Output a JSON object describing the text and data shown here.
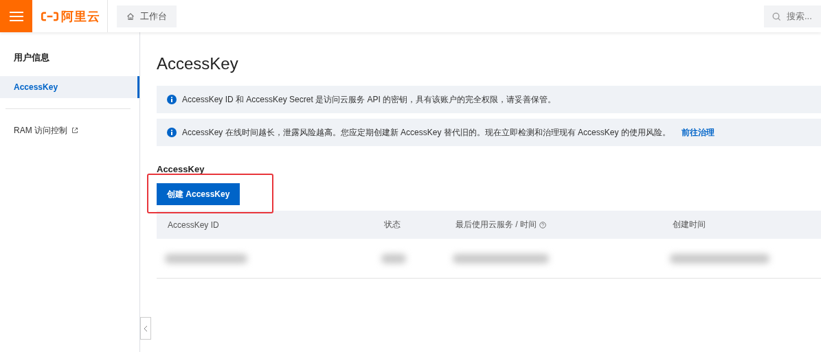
{
  "header": {
    "logo_text": "阿里云",
    "tab": "工作台",
    "search": {
      "placeholder": "搜索..."
    }
  },
  "sidebar": {
    "title": "用户信息",
    "items": [
      {
        "label": "AccessKey",
        "selected": true,
        "external": false
      },
      {
        "label": "RAM 访问控制",
        "selected": false,
        "external": true
      }
    ]
  },
  "page": {
    "title": "AccessKey",
    "alerts": [
      {
        "text": "AccessKey ID 和 AccessKey Secret 是访问云服务 API 的密钥，具有该账户的完全权限，请妥善保管。"
      },
      {
        "text": "AccessKey 在线时间越长，泄露风险越高。您应定期创建新 AccessKey 替代旧的。现在立即检测和治理现有 AccessKey 的使用风险。",
        "link": "前往治理"
      }
    ],
    "section_title": "AccessKey",
    "create_button": "创建 AccessKey",
    "table": {
      "columns": [
        {
          "label": "AccessKey ID",
          "help": false
        },
        {
          "label": "状态",
          "help": false
        },
        {
          "label": "最后使用云服务 / 时间",
          "help": true
        },
        {
          "label": "创建时间",
          "help": false
        }
      ],
      "rows": [
        {
          "kind": "redacted"
        }
      ]
    }
  }
}
